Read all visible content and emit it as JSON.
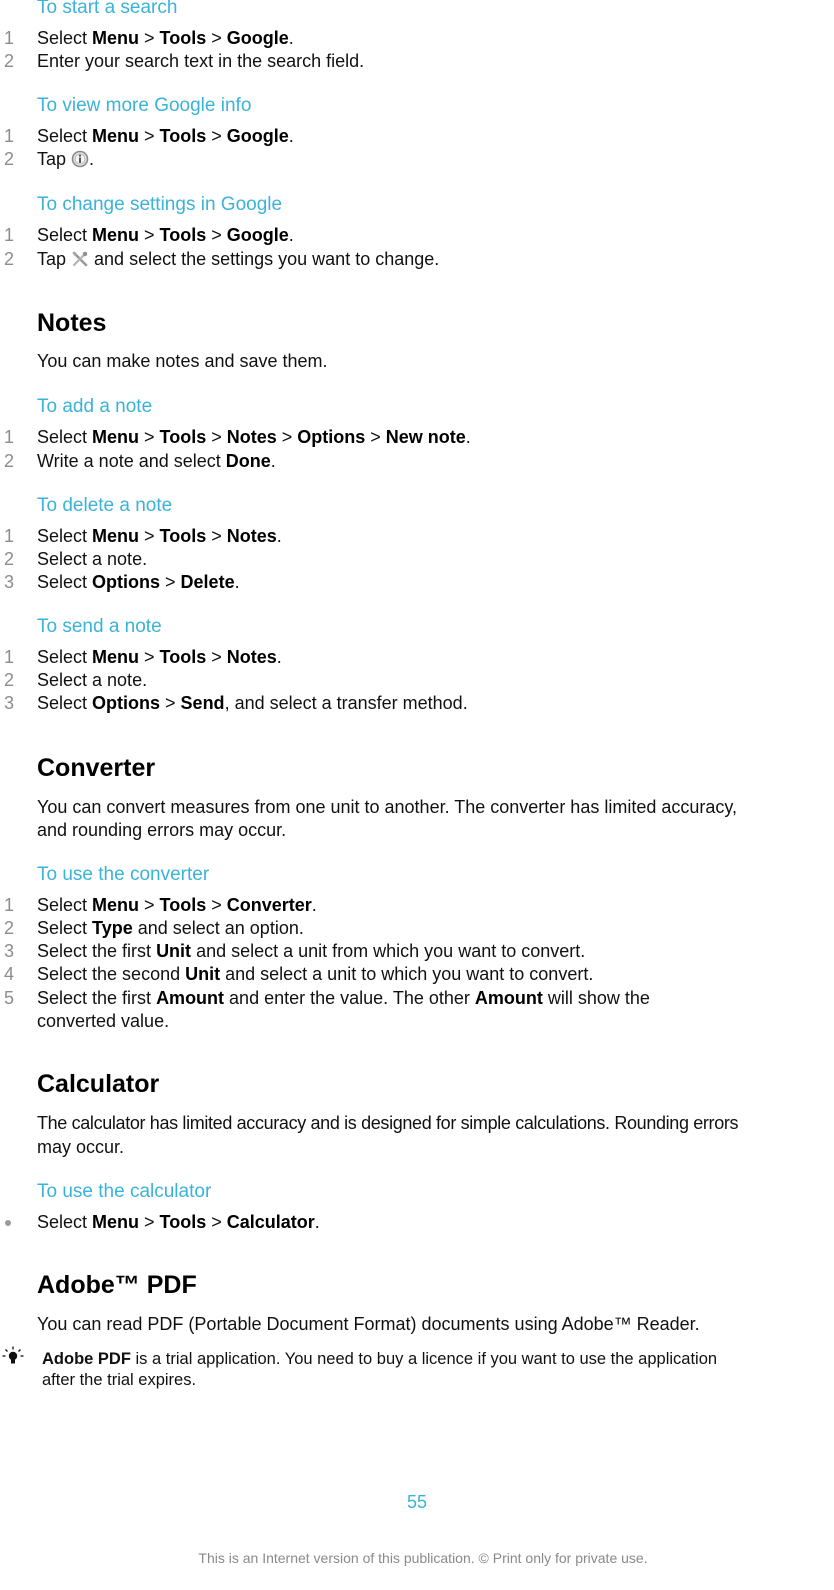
{
  "google": {
    "start_search": {
      "title": "To start a search",
      "steps": [
        {
          "num": "1",
          "parts": [
            [
              "Select ",
              false
            ],
            [
              "Menu",
              true
            ],
            [
              " > ",
              false
            ],
            [
              "Tools",
              true
            ],
            [
              " > ",
              false
            ],
            [
              "Google",
              true
            ],
            [
              ".",
              false
            ]
          ]
        },
        {
          "num": "2",
          "parts": [
            [
              "Enter your search text in the search field.",
              false
            ]
          ]
        }
      ]
    },
    "view_info": {
      "title": "To view more Google info",
      "steps": [
        {
          "num": "1",
          "parts": [
            [
              "Select ",
              false
            ],
            [
              "Menu",
              true
            ],
            [
              " > ",
              false
            ],
            [
              "Tools",
              true
            ],
            [
              " > ",
              false
            ],
            [
              "Google",
              true
            ],
            [
              ".",
              false
            ]
          ]
        },
        {
          "num": "2",
          "before": "Tap ",
          "icon": "info-icon",
          "after": "."
        }
      ]
    },
    "change_settings": {
      "title": "To change settings in Google",
      "steps": [
        {
          "num": "1",
          "parts": [
            [
              "Select ",
              false
            ],
            [
              "Menu",
              true
            ],
            [
              " > ",
              false
            ],
            [
              "Tools",
              true
            ],
            [
              " > ",
              false
            ],
            [
              "Google",
              true
            ],
            [
              ".",
              false
            ]
          ]
        },
        {
          "num": "2",
          "before": "Tap ",
          "icon": "settings-tools-icon",
          "after": " and select the settings you want to change."
        }
      ]
    }
  },
  "notes": {
    "heading": "Notes",
    "intro": "You can make notes and save them.",
    "add": {
      "title": "To add a note",
      "steps": [
        {
          "num": "1",
          "parts": [
            [
              "Select ",
              false
            ],
            [
              "Menu",
              true
            ],
            [
              " > ",
              false
            ],
            [
              "Tools",
              true
            ],
            [
              " > ",
              false
            ],
            [
              "Notes",
              true
            ],
            [
              " > ",
              false
            ],
            [
              "Options",
              true
            ],
            [
              " > ",
              false
            ],
            [
              "New note",
              true
            ],
            [
              ".",
              false
            ]
          ]
        },
        {
          "num": "2",
          "parts": [
            [
              "Write a note and select ",
              false
            ],
            [
              "Done",
              true
            ],
            [
              ".",
              false
            ]
          ]
        }
      ]
    },
    "delete": {
      "title": "To delete a note",
      "steps": [
        {
          "num": "1",
          "parts": [
            [
              "Select ",
              false
            ],
            [
              "Menu",
              true
            ],
            [
              " > ",
              false
            ],
            [
              "Tools",
              true
            ],
            [
              " > ",
              false
            ],
            [
              "Notes",
              true
            ],
            [
              ".",
              false
            ]
          ]
        },
        {
          "num": "2",
          "parts": [
            [
              "Select a note.",
              false
            ]
          ]
        },
        {
          "num": "3",
          "parts": [
            [
              "Select ",
              false
            ],
            [
              "Options",
              true
            ],
            [
              " > ",
              false
            ],
            [
              "Delete",
              true
            ],
            [
              ".",
              false
            ]
          ]
        }
      ]
    },
    "send": {
      "title": "To send a note",
      "steps": [
        {
          "num": "1",
          "parts": [
            [
              "Select ",
              false
            ],
            [
              "Menu",
              true
            ],
            [
              " > ",
              false
            ],
            [
              "Tools",
              true
            ],
            [
              " > ",
              false
            ],
            [
              "Notes",
              true
            ],
            [
              ".",
              false
            ]
          ]
        },
        {
          "num": "2",
          "parts": [
            [
              "Select a note.",
              false
            ]
          ]
        },
        {
          "num": "3",
          "parts": [
            [
              "Select ",
              false
            ],
            [
              "Options",
              true
            ],
            [
              " > ",
              false
            ],
            [
              "Send",
              true
            ],
            [
              ", and select a transfer method.",
              false
            ]
          ]
        }
      ]
    }
  },
  "converter": {
    "heading": "Converter",
    "intro_line1": "You can convert measures from one unit to another. The converter has limited accuracy,",
    "intro_line2": "and rounding errors may occur.",
    "use": {
      "title": "To use the converter",
      "steps": [
        {
          "num": "1",
          "parts": [
            [
              "Select ",
              false
            ],
            [
              "Menu",
              true
            ],
            [
              " > ",
              false
            ],
            [
              "Tools",
              true
            ],
            [
              " > ",
              false
            ],
            [
              "Converter",
              true
            ],
            [
              ".",
              false
            ]
          ]
        },
        {
          "num": "2",
          "parts": [
            [
              "Select ",
              false
            ],
            [
              "Type",
              true
            ],
            [
              " and select an option.",
              false
            ]
          ]
        },
        {
          "num": "3",
          "parts": [
            [
              "Select the first ",
              false
            ],
            [
              "Unit",
              true
            ],
            [
              " and select a unit from which you want to convert.",
              false
            ]
          ]
        },
        {
          "num": "4",
          "parts": [
            [
              "Select the second ",
              false
            ],
            [
              "Unit",
              true
            ],
            [
              " and select a unit to which you want to convert.",
              false
            ]
          ]
        },
        {
          "num": "5",
          "parts": [
            [
              "Select the first ",
              false
            ],
            [
              "Amount",
              true
            ],
            [
              " and enter the value. The other ",
              false
            ],
            [
              "Amount",
              true
            ],
            [
              " will show the",
              false
            ]
          ]
        },
        {
          "num": "",
          "parts": [
            [
              "converted value.",
              false
            ]
          ]
        }
      ]
    }
  },
  "calculator": {
    "heading": "Calculator",
    "intro_line1": "The calculator has limited accuracy and is designed for simple calculations. Rounding errors",
    "intro_line2": "may occur.",
    "use": {
      "title": "To use the calculator",
      "steps": [
        {
          "num": "",
          "bullet": true,
          "parts": [
            [
              "Select ",
              false
            ],
            [
              "Menu",
              true
            ],
            [
              " > ",
              false
            ],
            [
              "Tools",
              true
            ],
            [
              " > ",
              false
            ],
            [
              "Calculator",
              true
            ],
            [
              ".",
              false
            ]
          ]
        }
      ]
    }
  },
  "adobe": {
    "heading": "Adobe™ PDF",
    "intro": "You can read PDF (Portable Document Format) documents using Adobe™ Reader.",
    "tip_bold": "Adobe PDF",
    "tip_line1_rest": " is a trial application. You need to buy a licence if you want to use the application",
    "tip_line2": "after the trial expires."
  },
  "footer": {
    "page_number": "55",
    "notice": "This is an Internet version of this publication. © Print only for private use."
  },
  "colors": {
    "accent": "#3bb3d9",
    "step_number": "#8c8c8c",
    "footer_text": "#8a8a8a"
  }
}
